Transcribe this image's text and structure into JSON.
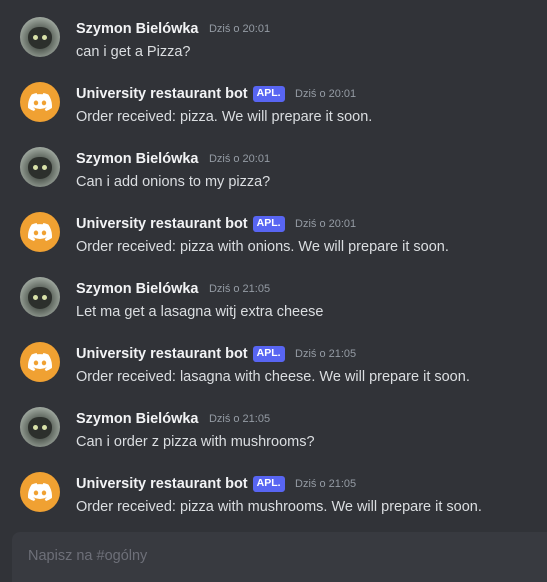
{
  "composer": {
    "placeholder": "Napisz na #ogólny"
  },
  "messages": [
    {
      "author": "Szymon Bielówka",
      "bot": false,
      "time": "Dziś o 20:01",
      "text": "can i get a Pizza?"
    },
    {
      "author": "University restaurant bot",
      "bot": true,
      "badge": "APL.",
      "time": "Dziś o 20:01",
      "text": "Order received: pizza. We will prepare it soon."
    },
    {
      "author": "Szymon Bielówka",
      "bot": false,
      "time": "Dziś o 20:01",
      "text": "Can i add onions to my pizza?"
    },
    {
      "author": "University restaurant bot",
      "bot": true,
      "badge": "APL.",
      "time": "Dziś o 20:01",
      "text": "Order received: pizza with onions. We will prepare it soon."
    },
    {
      "author": "Szymon Bielówka",
      "bot": false,
      "time": "Dziś o 21:05",
      "text": "Let ma get a lasagna witj extra cheese"
    },
    {
      "author": "University restaurant bot",
      "bot": true,
      "badge": "APL.",
      "time": "Dziś o 21:05",
      "text": "Order received: lasagna with cheese. We will prepare it soon."
    },
    {
      "author": "Szymon Bielówka",
      "bot": false,
      "time": "Dziś o 21:05",
      "text": "Can i order z pizza with mushrooms?"
    },
    {
      "author": "University restaurant bot",
      "bot": true,
      "badge": "APL.",
      "time": "Dziś o 21:05",
      "text": "Order received: pizza with mushrooms. We will prepare it soon."
    }
  ],
  "icons": {
    "bot_avatar": "discord-logo-icon",
    "user_avatar": "cat-photo-avatar"
  },
  "colors": {
    "background": "#313338",
    "bot_avatar": "#f0a132",
    "badge": "#5865f2",
    "input_bar": "#383a40"
  }
}
